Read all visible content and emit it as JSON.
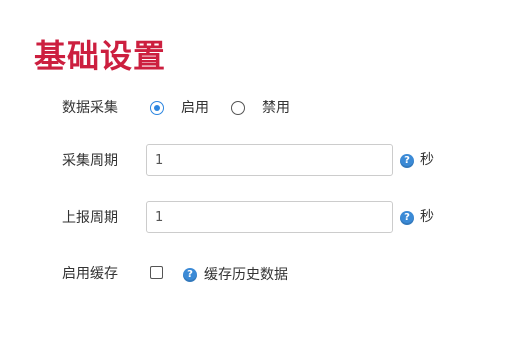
{
  "page": {
    "title": "基础设置"
  },
  "data_collection": {
    "label": "数据采集",
    "options": [
      {
        "label": "启用",
        "checked": true
      },
      {
        "label": "禁用",
        "checked": false
      }
    ]
  },
  "collection_period": {
    "label": "采集周期",
    "value": "1",
    "unit": "秒",
    "help_icon": "question-icon"
  },
  "report_period": {
    "label": "上报周期",
    "value": "1",
    "unit": "秒",
    "help_icon": "question-icon"
  },
  "enable_cache": {
    "label": "启用缓存",
    "checked": false,
    "help_icon": "question-icon",
    "help_text": "缓存历史数据"
  },
  "colors": {
    "title": "#cc1f3f",
    "accent": "#2d86e0",
    "help_icon": "#3b8ad6"
  }
}
